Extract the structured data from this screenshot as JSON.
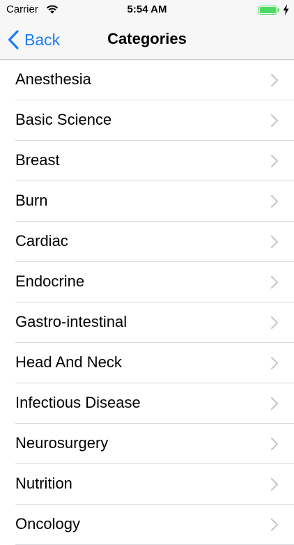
{
  "status_bar": {
    "carrier": "Carrier",
    "time": "5:54 AM",
    "battery_color": "#4cd964",
    "icons": [
      "wifi-icon",
      "battery-icon",
      "charging-bolt-icon"
    ]
  },
  "nav": {
    "back_label": "Back",
    "title": "Categories",
    "accent_color": "#1a7cf7"
  },
  "categories": [
    {
      "label": "Anesthesia"
    },
    {
      "label": "Basic Science"
    },
    {
      "label": "Breast"
    },
    {
      "label": "Burn"
    },
    {
      "label": "Cardiac"
    },
    {
      "label": "Endocrine"
    },
    {
      "label": "Gastro-intestinal"
    },
    {
      "label": "Head And Neck"
    },
    {
      "label": "Infectious Disease"
    },
    {
      "label": "Neurosurgery"
    },
    {
      "label": "Nutrition"
    },
    {
      "label": "Oncology"
    }
  ]
}
